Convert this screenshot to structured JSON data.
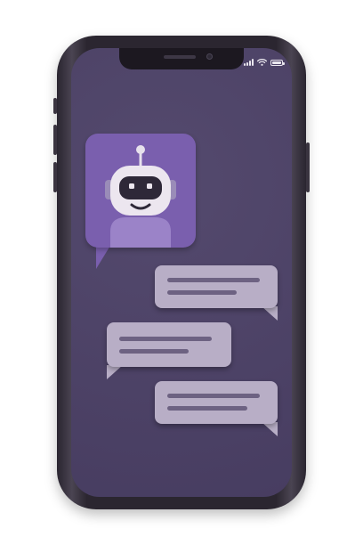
{
  "device": {
    "frame_color": "#2b2630",
    "screen_color": "#4b4066"
  },
  "status_bar": {
    "icons": [
      "signal-bars-icon",
      "wifi-icon",
      "battery-icon"
    ],
    "color": "#e9e6ee"
  },
  "chat": {
    "avatar": {
      "icon": "robot-icon",
      "background": "#7a5fae"
    },
    "bubbles": [
      {
        "side": "right",
        "color": "#b8aec6"
      },
      {
        "side": "left",
        "color": "#b8aec6"
      },
      {
        "side": "right",
        "color": "#b8aec6"
      }
    ]
  }
}
